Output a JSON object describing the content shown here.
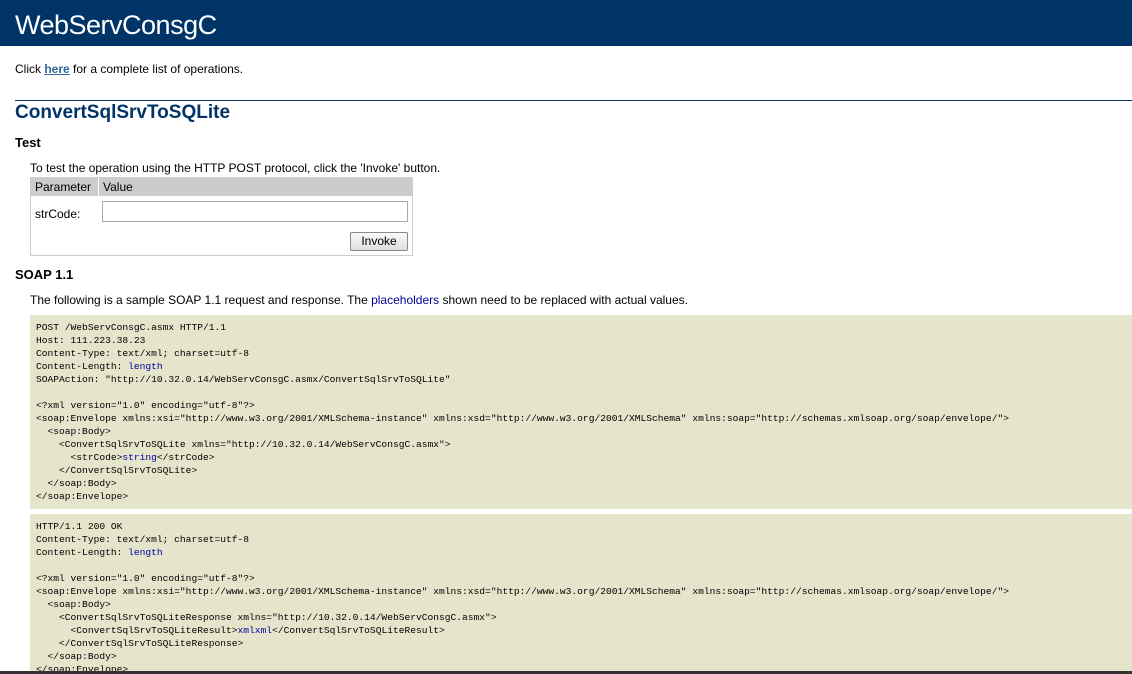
{
  "header": {
    "title": "WebServConsgC"
  },
  "intro": {
    "prefix": "Click ",
    "link_label": "here",
    "suffix": " for a complete list of operations."
  },
  "operation": {
    "title": "ConvertSqlSrvToSQLite"
  },
  "test": {
    "heading": "Test",
    "instructions": "To test the operation using the HTTP POST protocol, click the 'Invoke' button.",
    "col_parameter": "Parameter",
    "col_value": "Value",
    "param_label": "strCode:",
    "param_value": "",
    "invoke_label": "Invoke"
  },
  "soap11": {
    "heading": "SOAP 1.1",
    "desc_prefix": "The following is a sample SOAP 1.1 request and response. The ",
    "desc_link": "placeholders",
    "desc_suffix": " shown need to be replaced with actual values.",
    "request": {
      "l1": "POST /WebServConsgC.asmx HTTP/1.1",
      "l2": "Host: 111.223.38.23",
      "l3": "Content-Type: text/xml; charset=utf-8",
      "l4_prefix": "Content-Length: ",
      "l4_placeholder": "length",
      "l5": "SOAPAction: \"http://10.32.0.14/WebServConsgC.asmx/ConvertSqlSrvToSQLite\"",
      "l7": "<?xml version=\"1.0\" encoding=\"utf-8\"?>",
      "l8": "<soap:Envelope xmlns:xsi=\"http://www.w3.org/2001/XMLSchema-instance\" xmlns:xsd=\"http://www.w3.org/2001/XMLSchema\" xmlns:soap=\"http://schemas.xmlsoap.org/soap/envelope/\">",
      "l9": "  <soap:Body>",
      "l10": "    <ConvertSqlSrvToSQLite xmlns=\"http://10.32.0.14/WebServConsgC.asmx\">",
      "l11_prefix": "      <strCode>",
      "l11_placeholder": "string",
      "l11_suffix": "</strCode>",
      "l12": "    </ConvertSqlSrvToSQLite>",
      "l13": "  </soap:Body>",
      "l14": "</soap:Envelope>"
    },
    "response": {
      "l1": "HTTP/1.1 200 OK",
      "l2": "Content-Type: text/xml; charset=utf-8",
      "l3_prefix": "Content-Length: ",
      "l3_placeholder": "length",
      "l5": "<?xml version=\"1.0\" encoding=\"utf-8\"?>",
      "l6": "<soap:Envelope xmlns:xsi=\"http://www.w3.org/2001/XMLSchema-instance\" xmlns:xsd=\"http://www.w3.org/2001/XMLSchema\" xmlns:soap=\"http://schemas.xmlsoap.org/soap/envelope/\">",
      "l7": "  <soap:Body>",
      "l8": "    <ConvertSqlSrvToSQLiteResponse xmlns=\"http://10.32.0.14/WebServConsgC.asmx\">",
      "l9_prefix": "      <ConvertSqlSrvToSQLiteResult>",
      "l9_placeholder": "xmlxml",
      "l9_suffix": "</ConvertSqlSrvToSQLiteResult>",
      "l10": "    </ConvertSqlSrvToSQLiteResponse>",
      "l11": "  </soap:Body>",
      "l12": "</soap:Envelope>"
    }
  },
  "colors": {
    "header_bg": "#003366",
    "link": "#336699",
    "code_bg": "#e5e5cc",
    "placeholder": "#000099"
  }
}
